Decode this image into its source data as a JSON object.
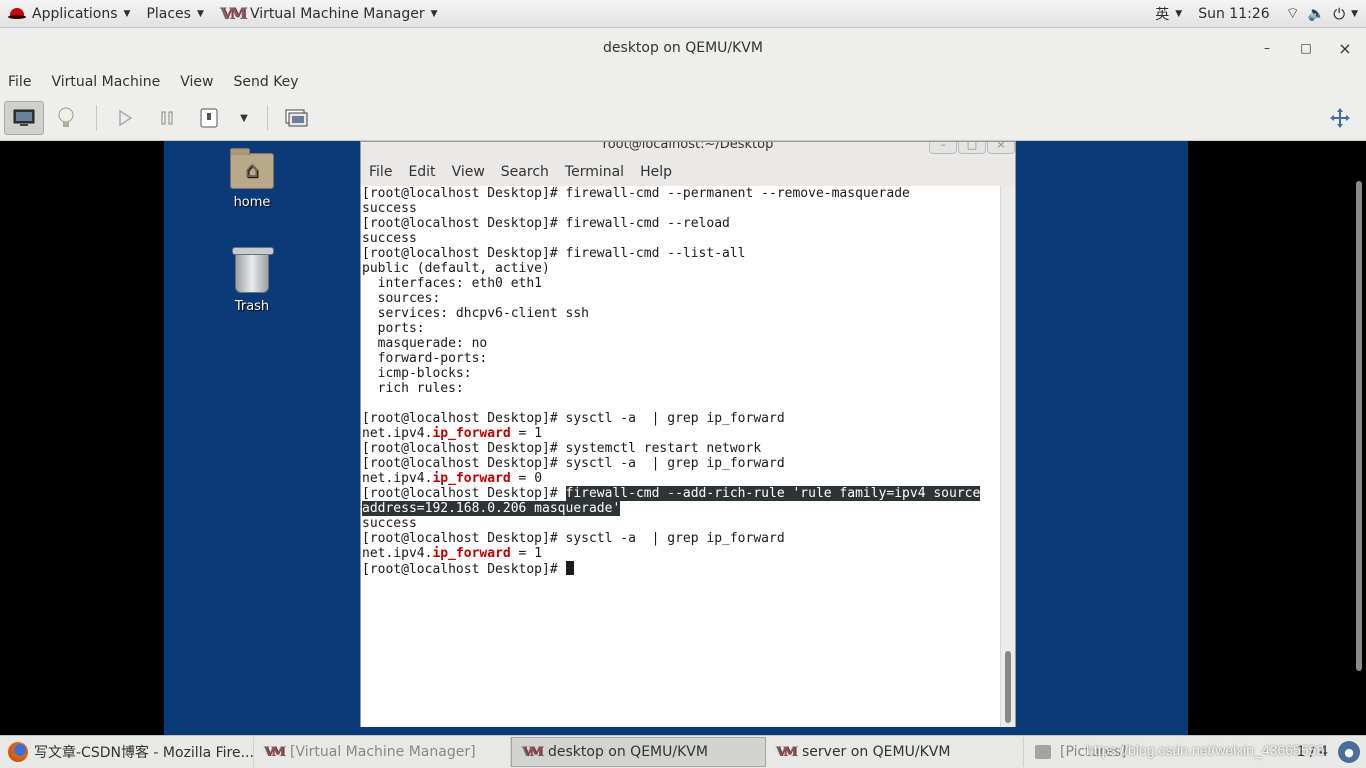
{
  "topbar": {
    "applications": "Applications",
    "places": "Places",
    "app_name": "Virtual Machine Manager",
    "input_method": "英",
    "clock": "Sun 11:26"
  },
  "window": {
    "title": "desktop on QEMU/KVM",
    "minimize": "–",
    "maximize": "□",
    "close": "×"
  },
  "menu": [
    "File",
    "Virtual Machine",
    "View",
    "Send Key"
  ],
  "desktop_icons": {
    "home": "home",
    "trash": "Trash"
  },
  "terminal": {
    "title": "root@localhost:~/Desktop",
    "menu": [
      "File",
      "Edit",
      "View",
      "Search",
      "Terminal",
      "Help"
    ],
    "lines": [
      "[root@localhost Desktop]# firewall-cmd --permanent --remove-masquerade",
      "success",
      "[root@localhost Desktop]# firewall-cmd --reload",
      "success",
      "[root@localhost Desktop]# firewall-cmd --list-all",
      "public (default, active)",
      "  interfaces: eth0 eth1",
      "  sources:",
      "  services: dhcpv6-client ssh",
      "  ports:",
      "  masquerade: no",
      "  forward-ports:",
      "  icmp-blocks:",
      "  rich rules:",
      "",
      "[root@localhost Desktop]# sysctl -a  | grep ip_forward",
      "net.ipv4.",
      "[root@localhost Desktop]# systemctl restart network",
      "[root@localhost Desktop]# sysctl -a  | grep ip_forward",
      "net.ipv4.",
      "[root@localhost Desktop]# ",
      "firewall-cmd --add-rich-rule 'rule family=ipv4 source",
      "address=192.168.0.206 masquerade'",
      "success",
      "[root@localhost Desktop]# sysctl -a  | grep ip_forward",
      "net.ipv4.",
      "[root@localhost Desktop]# "
    ],
    "ip_forward_kw": "ip_forward",
    "fwd_value_1": " = 1",
    "fwd_value_0": " = 0"
  },
  "taskbar": {
    "tasks": [
      "写文章-CSDN博客 - Mozilla Fire...",
      "[Virtual Machine Manager]",
      "desktop on QEMU/KVM",
      "server on QEMU/KVM",
      "[Pictures]"
    ],
    "pager": "1 / 4",
    "watermark": "https://blog.csdn.net/weixin_43665558"
  },
  "colors": {
    "vm_background": "#0b3a78",
    "terminal_keyword": "#c00000",
    "selection": "#2e3436"
  }
}
